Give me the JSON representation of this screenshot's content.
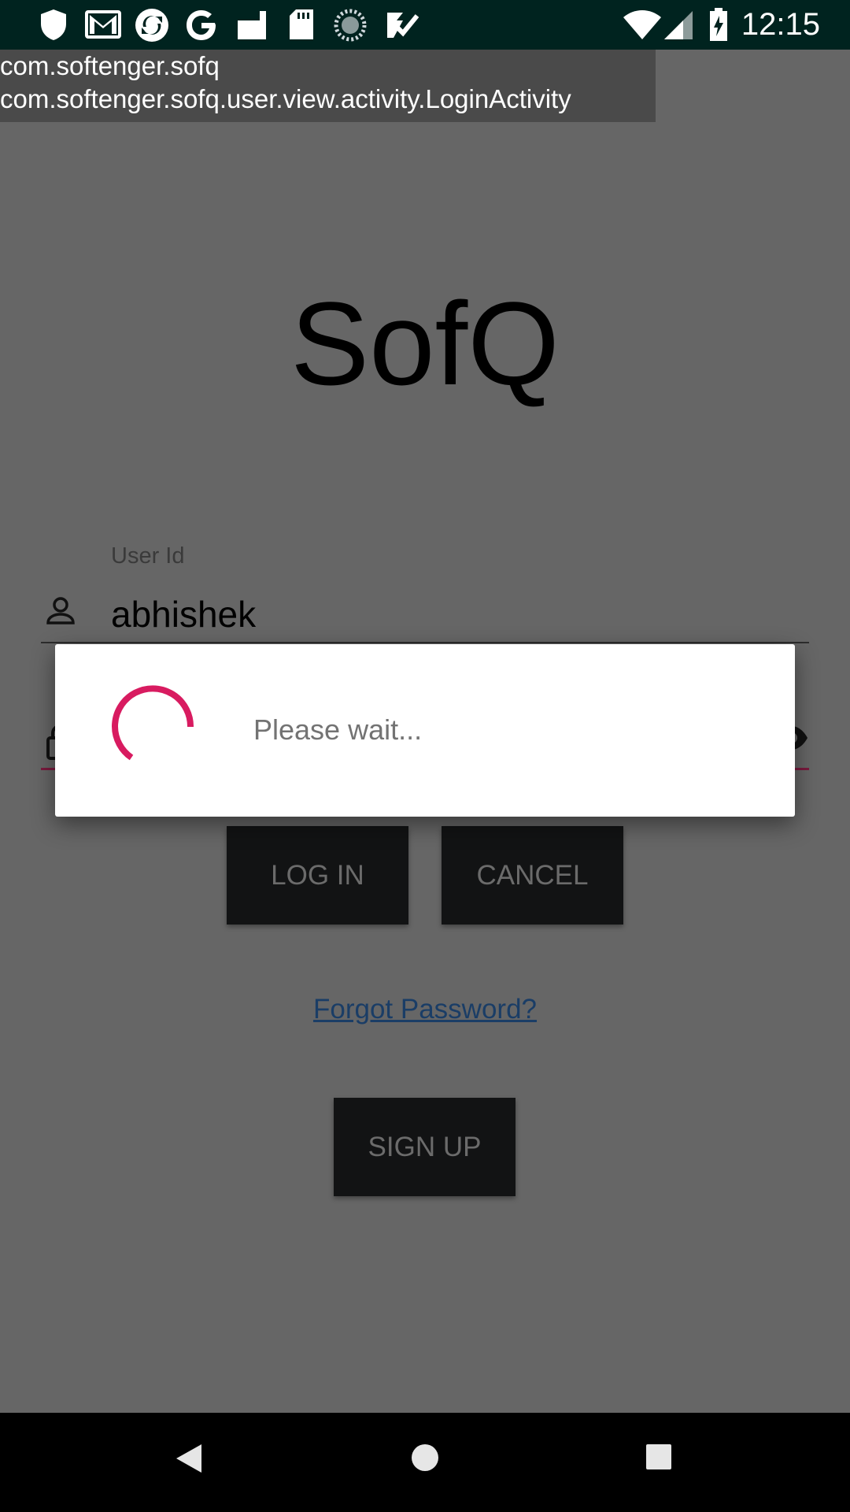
{
  "status_bar": {
    "time": "12:15",
    "left_icons": [
      "shield-icon",
      "gmail-icon",
      "sync-icon",
      "google-icon",
      "tablet-icon",
      "sd-card-icon",
      "progress-circle-icon",
      "tasks-check-icon"
    ],
    "right_icons": [
      "wifi-icon",
      "signal-icon",
      "battery-charging-icon"
    ]
  },
  "debug": {
    "package": "com.softenger.sofq",
    "activity": "com.softenger.sofq.user.view.activity.LoginActivity"
  },
  "app": {
    "title": "SofQ"
  },
  "form": {
    "user_label": "User Id",
    "user_value": "abhishek",
    "login_label": "LOG IN",
    "cancel_label": "CANCEL",
    "forgot_label": "Forgot Password?",
    "signup_label": "SIGN UP"
  },
  "dialog": {
    "message": "Please wait..."
  },
  "colors": {
    "accent": "#d81b60",
    "background": "#666666",
    "button": "#121314",
    "status_bar": "#00231f",
    "link": "#1a3d66"
  },
  "nav": {
    "icons": [
      "back-icon",
      "home-icon",
      "recents-icon"
    ]
  }
}
